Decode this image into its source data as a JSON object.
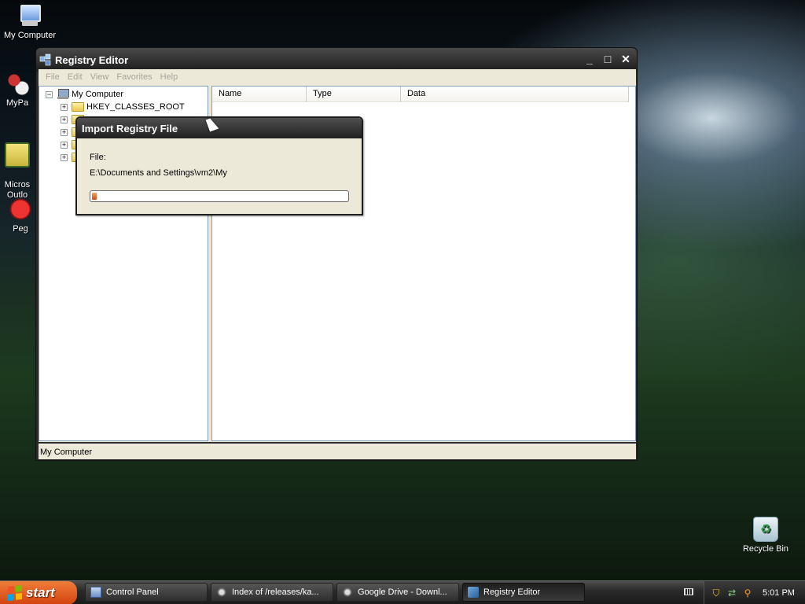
{
  "desktop": {
    "icons": [
      {
        "label": "My Computer",
        "icon": "computer-icon"
      },
      {
        "label": "MyPa",
        "icon": "mypal-icon"
      },
      {
        "label": "Micros\nOutlo",
        "icon": "outlook-icon"
      },
      {
        "label": "Peg",
        "icon": "peg-icon"
      },
      {
        "label": "Recycle Bin",
        "icon": "recycle-bin-icon"
      }
    ]
  },
  "window": {
    "title": "Registry Editor",
    "controls": {
      "minimize": "_",
      "maximize": "□",
      "close": "✕"
    },
    "menu": [
      "File",
      "Edit",
      "View",
      "Favorites",
      "Help"
    ],
    "tree": {
      "root": "My Computer",
      "items": [
        "HKEY_CLASSES_ROOT"
      ]
    },
    "columns": [
      "Name",
      "Type",
      "Data"
    ],
    "status": "My Computer"
  },
  "dialog": {
    "title": "Import Registry File",
    "file_label": "File:",
    "file_path": "E:\\Documents and Settings\\vm2\\My",
    "progress": 0.02
  },
  "taskbar": {
    "start_label": "start",
    "tasks": [
      {
        "label": "Control Panel",
        "icon": "control-panel-icon"
      },
      {
        "label": "Index of /releases/ka...",
        "icon": "web-icon"
      },
      {
        "label": "Google Drive - Downl...",
        "icon": "web-icon"
      },
      {
        "label": "Registry Editor",
        "icon": "registry-icon",
        "active": true
      }
    ],
    "clock": "5:01 PM"
  }
}
